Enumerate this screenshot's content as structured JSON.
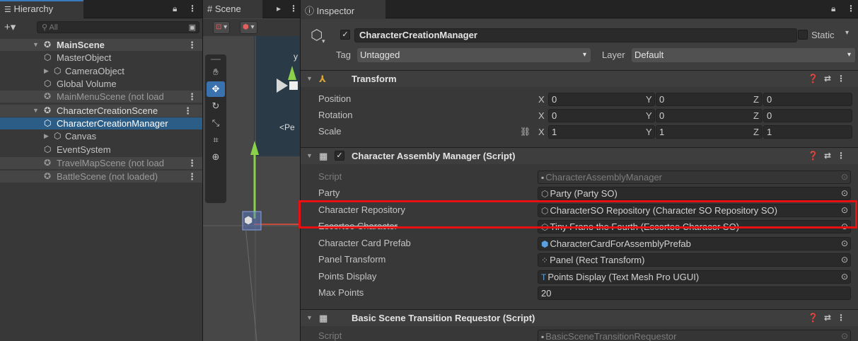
{
  "hierarchy": {
    "tab_label": "Hierarchy",
    "tab_icon": "list-icon",
    "search_placeholder": "All",
    "items": [
      {
        "label": "MainScene",
        "kind": "scene",
        "icon": "unity-scene-icon"
      },
      {
        "label": "MasterObject",
        "kind": "object",
        "icon": "gameobject-icon"
      },
      {
        "label": "CameraObject",
        "kind": "object",
        "icon": "gameobject-icon"
      },
      {
        "label": "Global Volume",
        "kind": "object",
        "icon": "gameobject-icon"
      },
      {
        "label": "MainMenuScene (not load",
        "kind": "scene",
        "icon": "unity-scene-icon"
      },
      {
        "label": "CharacterCreationScene",
        "kind": "scene",
        "icon": "unity-scene-icon"
      },
      {
        "label": "CharacterCreationManager",
        "kind": "object-selected",
        "icon": "gameobject-icon"
      },
      {
        "label": "Canvas",
        "kind": "object",
        "icon": "gameobject-icon"
      },
      {
        "label": "EventSystem",
        "kind": "object",
        "icon": "gameobject-icon"
      },
      {
        "label": "TravelMapScene (not load",
        "kind": "scene",
        "icon": "unity-scene-icon"
      },
      {
        "label": "BattleScene (not loaded)",
        "kind": "scene",
        "icon": "unity-scene-icon"
      }
    ]
  },
  "scene": {
    "tab_label": "Scene",
    "gizmo_label": "y",
    "perspective_label": "<Pe"
  },
  "inspector": {
    "tab_label": "Inspector",
    "object_name": "CharacterCreationManager",
    "active": true,
    "static_label": "Static",
    "tag_label": "Tag",
    "tag_value": "Untagged",
    "layer_label": "Layer",
    "layer_value": "Default",
    "transform": {
      "title": "Transform",
      "rows": [
        {
          "label": "Position",
          "x": "0",
          "y": "0",
          "z": "0"
        },
        {
          "label": "Rotation",
          "x": "0",
          "y": "0",
          "z": "0"
        },
        {
          "label": "Scale",
          "x": "1",
          "y": "1",
          "z": "1"
        }
      ],
      "axis_x": "X",
      "axis_y": "Y",
      "axis_z": "Z"
    },
    "assembly_manager": {
      "title": "Character Assembly Manager (Script)",
      "enabled": true,
      "fields": [
        {
          "label": "Script",
          "value": "CharacterAssemblyManager",
          "icon": "script-icon",
          "dim": true
        },
        {
          "label": "Party",
          "value": "Party (Party SO)",
          "icon": "scriptable-object-icon"
        },
        {
          "label": "Character Repository",
          "value": "CharacterSO Repository (Character SO Repository SO)",
          "icon": "scriptable-object-icon"
        },
        {
          "label": "Escortee Character",
          "value": "Tiny Frane the Fourth (Escortee Characer SO)",
          "icon": "scriptable-object-icon"
        },
        {
          "label": "Character Card Prefab",
          "value": "CharacterCardForAssemblyPrefab",
          "icon": "prefab-icon"
        },
        {
          "label": "Panel Transform",
          "value": "Panel (Rect Transform)",
          "icon": "rect-transform-icon"
        },
        {
          "label": "Points Display",
          "value": "Points Display (Text Mesh Pro UGUI)",
          "icon": "textmeshpro-icon"
        },
        {
          "label": "Max Points",
          "value": "20",
          "icon": ""
        }
      ]
    },
    "transition_requestor": {
      "title": "Basic Scene Transition Requestor (Script)",
      "script_label": "Script",
      "script_value": "BasicSceneTransitionRequestor"
    }
  },
  "highlight": {
    "target": "Character Repository",
    "color": "#e81010"
  }
}
